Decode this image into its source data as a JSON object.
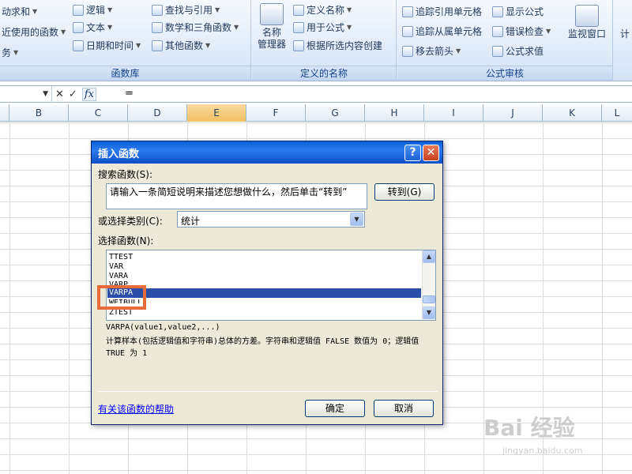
{
  "ribbon": {
    "groups": [
      {
        "label": "函数库",
        "items": [
          "动求和",
          "逻辑",
          "查找与引用",
          "近使用的函数",
          "文本",
          "数学和三角函数",
          "务",
          "日期和时间",
          "其他函数"
        ]
      },
      {
        "label": "定义的名称",
        "big_button": [
          "名称",
          "管理器"
        ],
        "items": [
          "定义名称",
          "用于公式",
          "根据所选内容创建"
        ]
      },
      {
        "label": "公式审核",
        "items": [
          "追踪引用单元格",
          "显示公式",
          "追踪从属单元格",
          "错误检查",
          "移去箭头",
          "公式求值"
        ],
        "big_button": "监视窗口"
      }
    ],
    "last_label": "计"
  },
  "formula_bar": {
    "text": "="
  },
  "columns": [
    "B",
    "C",
    "D",
    "E",
    "F",
    "G",
    "H",
    "I",
    "J",
    "K",
    "L"
  ],
  "active_column": "E",
  "dialog": {
    "title": "插入函数",
    "help_button": "?",
    "close_button": "✕",
    "search_label": "搜索函数(S):",
    "search_text": "请输入一条简短说明来描述您想做什么，然后单击“转到”",
    "go_button": "转到(G)",
    "category_label": "或选择类别(C):",
    "category_value": "统计",
    "function_label": "选择函数(N):",
    "functions": [
      "TTEST",
      "VAR",
      "VARA",
      "VARP",
      "VARPA",
      "WEIBULL",
      "ZTEST"
    ],
    "selected_function": "VARPA",
    "syntax": "VARPA(value1,value2,...)",
    "description": "计算样本(包括逻辑值和字符串)总体的方差。字符串和逻辑值 FALSE 数值为 0；逻辑值 TRUE 为 1",
    "help_link": "有关该函数的帮助",
    "ok_button": "确定",
    "cancel_button": "取消"
  },
  "watermark": {
    "brand": "Bai 经验",
    "url": "jingyan.baidu.com"
  }
}
